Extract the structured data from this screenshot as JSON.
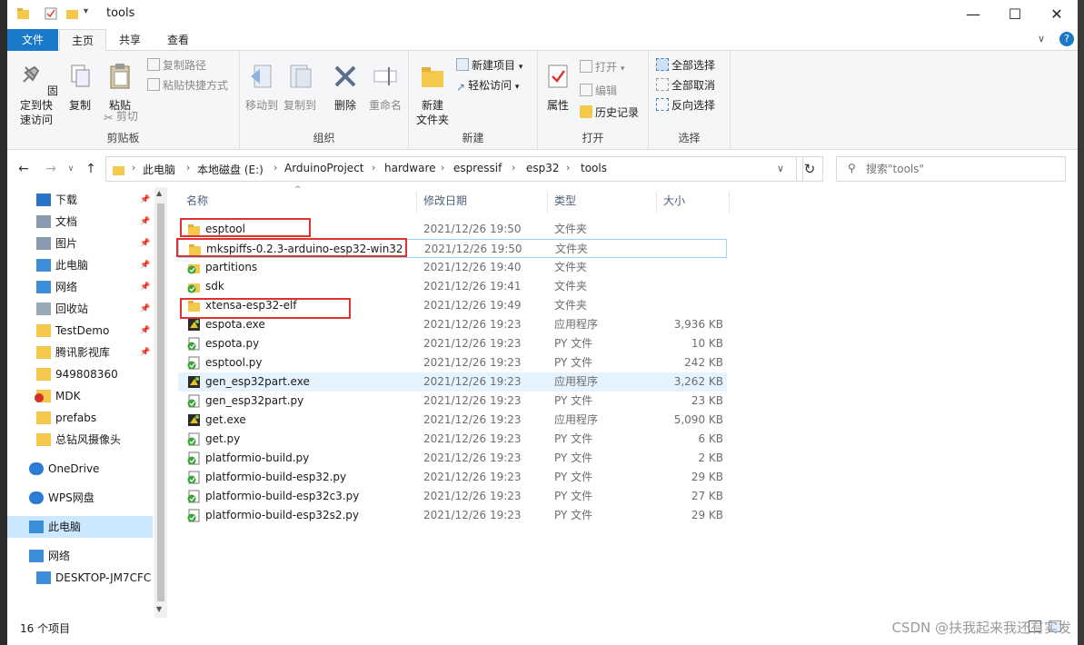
{
  "window": {
    "title": "tools",
    "minimize": "—",
    "maximize": "☐",
    "close": "✕"
  },
  "ribbon_tabs": [
    "文件",
    "主页",
    "共享",
    "查看"
  ],
  "ribbon": {
    "clipboard": {
      "pin": "固定到快\n速访问",
      "copy": "复制",
      "paste": "粘贴",
      "copy_path": "复制路径",
      "paste_shortcut": "粘贴快捷方式",
      "cut": "剪切",
      "title": "剪贴板"
    },
    "organize": {
      "move_to": "移动到",
      "copy_to": "复制到",
      "delete": "删除",
      "rename": "重命名",
      "title": "组织"
    },
    "new": {
      "new_folder": "新建\n文件夹",
      "new_item": "新建项目",
      "easy_access": "轻松访问",
      "title": "新建"
    },
    "open": {
      "properties": "属性",
      "open": "打开",
      "edit": "编辑",
      "history": "历史记录",
      "title": "打开"
    },
    "select": {
      "select_all": "全部选择",
      "select_none": "全部取消",
      "invert": "反向选择",
      "title": "选择"
    }
  },
  "breadcrumbs": [
    "此电脑",
    "本地磁盘 (E:)",
    "ArduinoProject",
    "hardware",
    "espressif",
    "esp32",
    "tools"
  ],
  "search": {
    "placeholder": "搜索\"tools\""
  },
  "sidebar": [
    {
      "label": "下载",
      "icon": "download-icon",
      "pinned": true
    },
    {
      "label": "文档",
      "icon": "document-icon",
      "pinned": true
    },
    {
      "label": "图片",
      "icon": "picture-icon",
      "pinned": true
    },
    {
      "label": "此电脑",
      "icon": "computer-icon",
      "pinned": true
    },
    {
      "label": "网络",
      "icon": "network-icon",
      "pinned": true
    },
    {
      "label": "回收站",
      "icon": "recycle-bin-icon",
      "pinned": true
    },
    {
      "label": "TestDemo",
      "icon": "folder-icon",
      "pinned": true
    },
    {
      "label": "腾讯影视库",
      "icon": "folder-icon",
      "pinned": true
    },
    {
      "label": "949808360",
      "icon": "folder-icon",
      "pinned": false
    },
    {
      "label": "MDK",
      "icon": "folder-error-icon",
      "pinned": false
    },
    {
      "label": "prefabs",
      "icon": "folder-icon",
      "pinned": false
    },
    {
      "label": "总钻风摄像头",
      "icon": "folder-icon",
      "pinned": false
    },
    {
      "label": "OneDrive",
      "icon": "cloud-icon",
      "pinned": false
    },
    {
      "label": "WPS网盘",
      "icon": "cloud-icon",
      "pinned": false
    },
    {
      "label": "此电脑",
      "icon": "computer-icon",
      "pinned": false
    },
    {
      "label": "网络",
      "icon": "network-icon",
      "pinned": false
    },
    {
      "label": "DESKTOP-JM7CFC",
      "icon": "computer-icon",
      "pinned": false
    }
  ],
  "columns": {
    "name": "名称",
    "date": "修改日期",
    "type": "类型",
    "size": "大小"
  },
  "files": [
    {
      "name": "esptool",
      "date": "2021/12/26 19:50",
      "type": "文件夹",
      "size": "",
      "icon": "folder-icon"
    },
    {
      "name": "mkspiffs-0.2.3-arduino-esp32-win32",
      "date": "2021/12/26 19:50",
      "type": "文件夹",
      "size": "",
      "icon": "folder-icon"
    },
    {
      "name": "partitions",
      "date": "2021/12/26 19:40",
      "type": "文件夹",
      "size": "",
      "icon": "folder-synced-icon"
    },
    {
      "name": "sdk",
      "date": "2021/12/26 19:41",
      "type": "文件夹",
      "size": "",
      "icon": "folder-synced-icon"
    },
    {
      "name": "xtensa-esp32-elf",
      "date": "2021/12/26 19:49",
      "type": "文件夹",
      "size": "",
      "icon": "folder-icon"
    },
    {
      "name": "espota.exe",
      "date": "2021/12/26 19:23",
      "type": "应用程序",
      "size": "3,936 KB",
      "icon": "exe-icon"
    },
    {
      "name": "espota.py",
      "date": "2021/12/26 19:23",
      "type": "PY 文件",
      "size": "10 KB",
      "icon": "python-file-icon"
    },
    {
      "name": "esptool.py",
      "date": "2021/12/26 19:23",
      "type": "PY 文件",
      "size": "242 KB",
      "icon": "python-file-icon"
    },
    {
      "name": "gen_esp32part.exe",
      "date": "2021/12/26 19:23",
      "type": "应用程序",
      "size": "3,262 KB",
      "icon": "exe-icon"
    },
    {
      "name": "gen_esp32part.py",
      "date": "2021/12/26 19:23",
      "type": "PY 文件",
      "size": "23 KB",
      "icon": "python-file-icon"
    },
    {
      "name": "get.exe",
      "date": "2021/12/26 19:23",
      "type": "应用程序",
      "size": "5,090 KB",
      "icon": "exe-icon"
    },
    {
      "name": "get.py",
      "date": "2021/12/26 19:23",
      "type": "PY 文件",
      "size": "6 KB",
      "icon": "python-file-icon"
    },
    {
      "name": "platformio-build.py",
      "date": "2021/12/26 19:23",
      "type": "PY 文件",
      "size": "2 KB",
      "icon": "python-file-icon"
    },
    {
      "name": "platformio-build-esp32.py",
      "date": "2021/12/26 19:23",
      "type": "PY 文件",
      "size": "29 KB",
      "icon": "python-file-icon"
    },
    {
      "name": "platformio-build-esp32c3.py",
      "date": "2021/12/26 19:23",
      "type": "PY 文件",
      "size": "27 KB",
      "icon": "python-file-icon"
    },
    {
      "name": "platformio-build-esp32s2.py",
      "date": "2021/12/26 19:23",
      "type": "PY 文件",
      "size": "29 KB",
      "icon": "python-file-icon"
    }
  ],
  "status": {
    "count": "16 个项目"
  },
  "watermark": "CSDN @扶我起来我还有实发",
  "colors": {
    "accent": "#1979ca",
    "highlight": "#e03131",
    "folder": "#f3c84b"
  }
}
